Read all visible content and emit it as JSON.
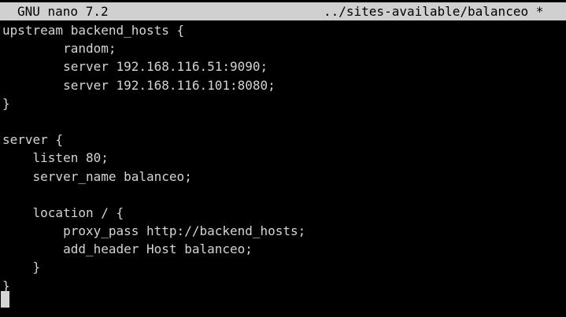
{
  "titlebar": {
    "app_name": "GNU nano 7.2",
    "file_name": "../sites-available/balanceo *"
  },
  "editor": {
    "lines": [
      "upstream backend_hosts {",
      "        random;",
      "        server 192.168.116.51:9090;",
      "        server 192.168.116.101:8080;",
      "}",
      "",
      "server {",
      "    listen 80;",
      "    server_name balanceo;",
      "",
      "    location / {",
      "        proxy_pass http://backend_hosts;",
      "        add_header Host balanceo;",
      "    }",
      "}"
    ]
  },
  "colors": {
    "background": "#000000",
    "text": "#d4d4d4",
    "titlebar_bg": "#d0d0d0",
    "titlebar_text": "#000000"
  }
}
